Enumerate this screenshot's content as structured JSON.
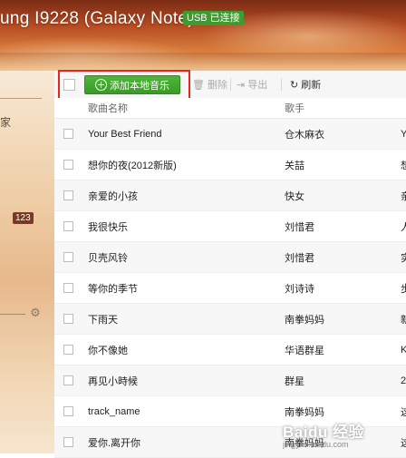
{
  "header": {
    "device_title": "ung I9228 (Galaxy Note)",
    "usb_badge": "USB 已连接"
  },
  "sidebar": {
    "fragment_text": "家",
    "count_badge": "123"
  },
  "toolbar": {
    "add_local_music": "添加本地音乐",
    "delete": "删除",
    "export": "导出",
    "refresh": "刷新"
  },
  "table": {
    "columns": [
      "歌曲名称",
      "歌手",
      ""
    ],
    "rows": [
      {
        "name": "Your Best Friend",
        "artist": "仓木麻衣",
        "album": "Y"
      },
      {
        "name": "想你的夜(2012新版)",
        "artist": "关喆",
        "album": "想"
      },
      {
        "name": "亲爱的小孩",
        "artist": "快女",
        "album": "亲"
      },
      {
        "name": "我很快乐",
        "artist": "刘惜君",
        "album": "人"
      },
      {
        "name": "贝壳风铃",
        "artist": "刘惜君",
        "album": "实"
      },
      {
        "name": "等你的季节",
        "artist": "刘诗诗",
        "album": "步"
      },
      {
        "name": "下雨天",
        "artist": "南拳妈妈",
        "album": "新"
      },
      {
        "name": "你不像她",
        "artist": "华语群星",
        "album": "K"
      },
      {
        "name": "再见小時候",
        "artist": "群星",
        "album": "2"
      },
      {
        "name": "track_name",
        "artist": "南拳妈妈",
        "album": "这"
      },
      {
        "name": "爱你.离开你",
        "artist": "南拳妈妈",
        "album": "这"
      }
    ]
  },
  "watermark": {
    "text": "Baidu 经验",
    "sub": "jingyan.baidu.com"
  },
  "colors": {
    "accent_green": "#3a9a28",
    "highlight_red": "#e3261f",
    "badge_brown": "#7a3a22"
  }
}
